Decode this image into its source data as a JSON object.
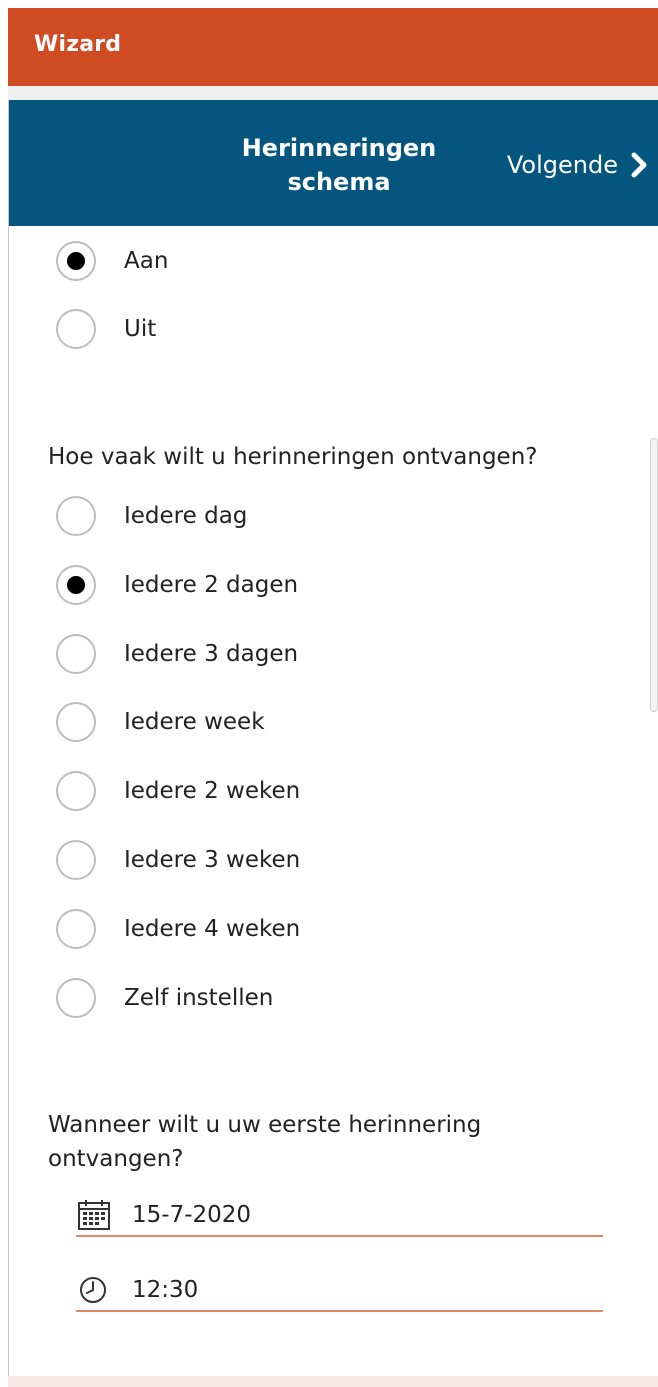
{
  "app": {
    "title": "Wizard"
  },
  "header": {
    "title": "Herinneringen schema",
    "next_label": "Volgende"
  },
  "reminder_toggle": {
    "options": [
      {
        "label": "Aan",
        "checked": true
      },
      {
        "label": "Uit",
        "checked": false
      }
    ]
  },
  "frequency": {
    "question": "Hoe vaak wilt u herinneringen ontvangen?",
    "options": [
      {
        "label": "Iedere dag",
        "checked": false
      },
      {
        "label": "Iedere 2 dagen",
        "checked": true
      },
      {
        "label": "Iedere 3 dagen",
        "checked": false
      },
      {
        "label": "Iedere week",
        "checked": false
      },
      {
        "label": "Iedere 2 weken",
        "checked": false
      },
      {
        "label": "Iedere 3 weken",
        "checked": false
      },
      {
        "label": "Iedere 4 weken",
        "checked": false
      },
      {
        "label": "Zelf instellen",
        "checked": false
      }
    ]
  },
  "first_reminder": {
    "question": "Wanneer wilt u uw eerste herinnering ontvangen?",
    "date": {
      "value": "15-7-2020",
      "icon": "calendar-icon"
    },
    "time": {
      "value": "12:30",
      "icon": "clock-icon"
    }
  },
  "colors": {
    "title_bar": "#d04a22",
    "header": "#04567f",
    "field_underline": "#e08a68"
  }
}
